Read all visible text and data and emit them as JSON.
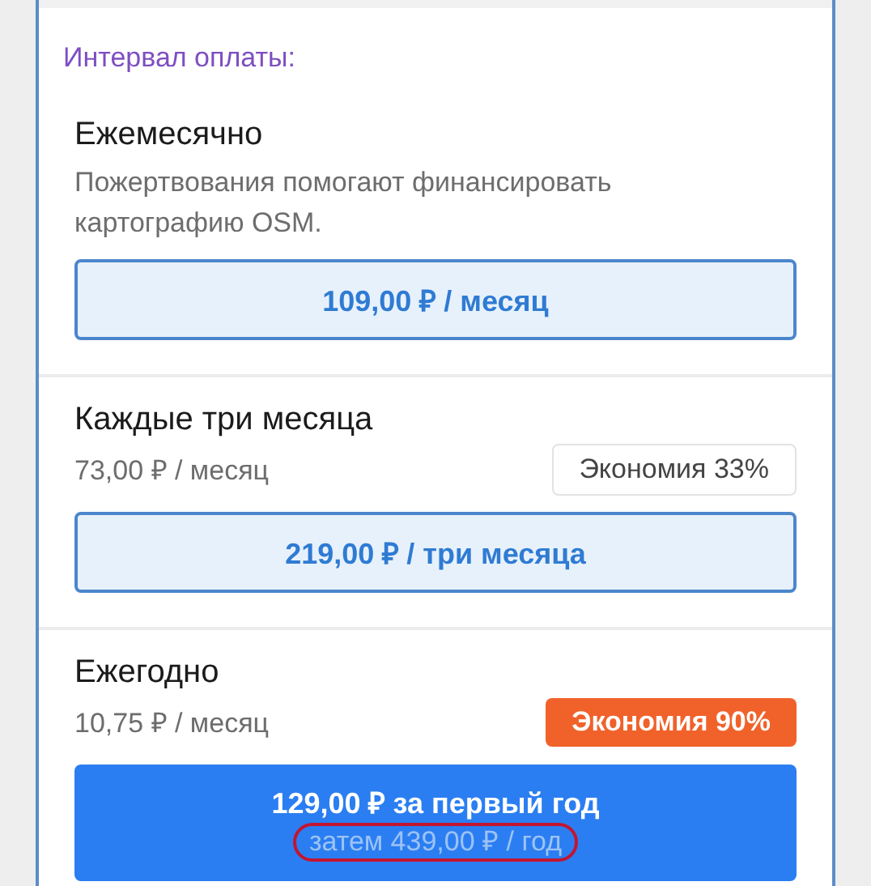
{
  "section_label": "Интервал оплаты:",
  "plans": [
    {
      "title": "Ежемесячно",
      "description": "Пожертвования помогают финансировать картографию OSM.",
      "button": {
        "kind": "secondary",
        "label": "109,00 ₽ / месяц"
      }
    },
    {
      "title": "Каждые три месяца",
      "per_month": "73,00 ₽ / месяц",
      "badge": {
        "kind": "plain",
        "text": "Экономия 33%"
      },
      "button": {
        "kind": "secondary",
        "label": "219,00 ₽ / три месяца"
      }
    },
    {
      "title": "Ежегодно",
      "per_month": "10,75 ₽ / месяц",
      "badge": {
        "kind": "accent",
        "text": "Экономия 90%"
      },
      "button": {
        "kind": "primary",
        "label": "129,00 ₽ за первый год",
        "sublabel": "затем 439,00 ₽ / год",
        "sublabel_circled": true
      }
    }
  ]
}
